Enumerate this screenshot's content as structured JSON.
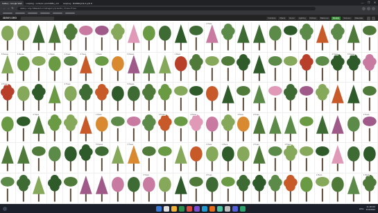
{
  "browser": {
    "tabs": [
      {
        "label": "Gallery - Google Wall",
        "active": true
      },
      {
        "label": "Ladybug - contexto yard.IIRBH_4.D",
        "active": false
      },
      {
        "label": "Ladybug - BARBEQUE & grill R",
        "active": false
      }
    ],
    "url": "3dsky.org/3dmodels/category/plants_trees/tree",
    "window_buttons": [
      "—",
      "❐",
      "✕"
    ]
  },
  "site": {
    "logo": "3DSKY.ORG",
    "categories": [
      {
        "label": "Furniture"
      },
      {
        "label": "Plants"
      },
      {
        "label": "Decor"
      },
      {
        "label": "Lighting"
      },
      {
        "label": "Kitchen"
      },
      {
        "label": "Bathroom"
      },
      {
        "label": "Models",
        "highlight": true
      },
      {
        "label": "Textures"
      },
      {
        "label": "Materials"
      }
    ]
  },
  "labels": {
    "tree_count": "1 Piece",
    "tree_count_variant": "3 Trees",
    "pieces": "5 Pieces"
  },
  "colors": {
    "tree_greens": [
      "#4f7a3a",
      "#6b9a45",
      "#3e6b34",
      "#86a85a",
      "#5c8a48",
      "#2f5a2a"
    ],
    "autumn": [
      "#c85a2a",
      "#d98a30",
      "#b8402a"
    ],
    "blossom": [
      "#c87aa0",
      "#a05a8a",
      "#e09ab8"
    ],
    "trunk": "#5a4632"
  },
  "taskbar": {
    "tray_lang": "ENG",
    "time": "11:48 PM",
    "date": "4/13/2024"
  }
}
